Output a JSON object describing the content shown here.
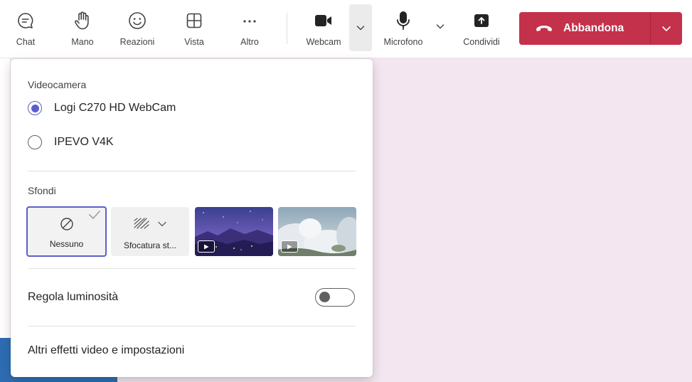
{
  "toolbar": {
    "chat_label": "Chat",
    "hand_label": "Mano",
    "reactions_label": "Reazioni",
    "view_label": "Vista",
    "more_label": "Altro",
    "webcam_label": "Webcam",
    "mic_label": "Microfono",
    "share_label": "Condividi",
    "leave_label": "Abbandona"
  },
  "panel": {
    "camera_title": "Videocamera",
    "cameras": [
      {
        "label": "Logi C270 HD WebCam",
        "selected": true
      },
      {
        "label": "IPEVO V4K",
        "selected": false
      }
    ],
    "backgrounds_title": "Sfondi",
    "backgrounds": {
      "none_label": "Nessuno",
      "blur_label": "Sfocatura st..."
    },
    "brightness_label": "Regola luminosità",
    "brightness_on": false,
    "more_effects_label": "Altri effetti video e impostazioni"
  },
  "colors": {
    "accent": "#5b5fc7",
    "leave": "#c4314b",
    "stage": "#f3e6f0"
  }
}
